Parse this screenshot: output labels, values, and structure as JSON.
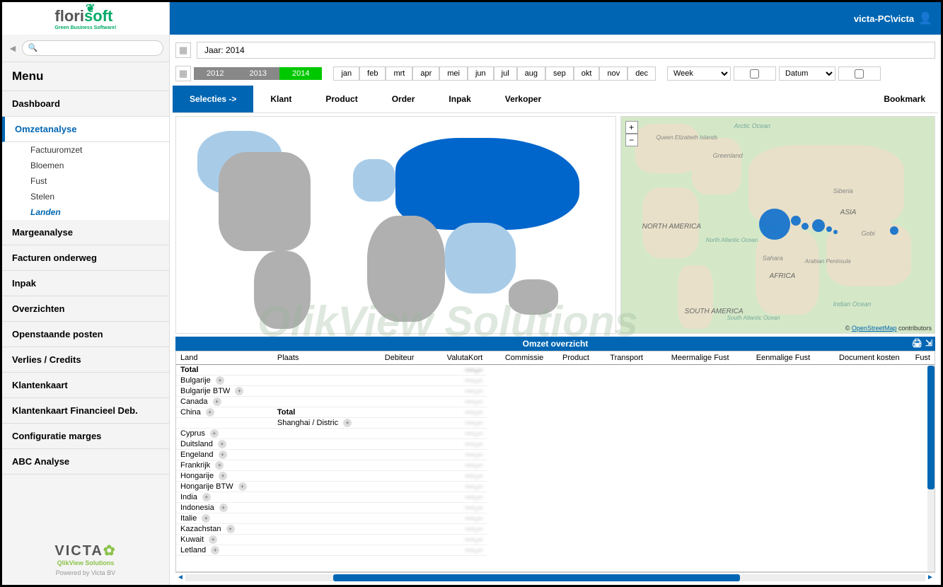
{
  "header": {
    "logo_main": "florisoft",
    "logo_sub": "Green Business Software!",
    "user": "victa-PC\\victa"
  },
  "sidebar": {
    "menu_title": "Menu",
    "items": [
      {
        "label": "Dashboard"
      },
      {
        "label": "Omzetanalyse",
        "active": true,
        "sub": [
          {
            "label": "Factuuromzet"
          },
          {
            "label": "Bloemen"
          },
          {
            "label": "Fust"
          },
          {
            "label": "Stelen"
          },
          {
            "label": "Landen",
            "active": true
          }
        ]
      },
      {
        "label": "Margeanalyse"
      },
      {
        "label": "Facturen onderweg"
      },
      {
        "label": "Inpak"
      },
      {
        "label": "Overzichten"
      },
      {
        "label": "Openstaande posten"
      },
      {
        "label": "Verlies / Credits"
      },
      {
        "label": "Klantenkaart"
      },
      {
        "label": "Klantenkaart Financieel Deb."
      },
      {
        "label": "Configuratie marges"
      },
      {
        "label": "ABC Analyse"
      }
    ],
    "footer": {
      "brand": "VICTA",
      "sub": "QlikView Solutions",
      "powered": "Powered by Victa BV"
    }
  },
  "filters": {
    "jaar_label": "Jaar: 2014",
    "years": [
      "2012",
      "2013",
      "2014"
    ],
    "year_active": "2014",
    "months": [
      "jan",
      "feb",
      "mrt",
      "apr",
      "mei",
      "jun",
      "jul",
      "aug",
      "sep",
      "okt",
      "nov",
      "dec"
    ],
    "week_label": "Week",
    "datum_label": "Datum"
  },
  "tabs": {
    "items": [
      "Selecties ->",
      "Klant",
      "Product",
      "Order",
      "Inpak",
      "Verkoper"
    ],
    "active": "Selecties ->",
    "bookmark": "Bookmark"
  },
  "map2": {
    "credit_prefix": "© ",
    "credit_link": "OpenStreetMap",
    "credit_suffix": " contributors",
    "labels": {
      "arctic": "Arctic Ocean",
      "greenland": "Greenland",
      "na": "NORTH AMERICA",
      "sa": "SOUTH AMERICA",
      "africa": "AFRICA",
      "asia": "ASIA",
      "siberia": "Siberia",
      "sahara": "Sahara",
      "gobi": "Gobi",
      "indian": "Indian Ocean",
      "natl": "North Atlantic Ocean",
      "satl": "South Atlantic Ocean",
      "arabian": "Arabian Peninsula",
      "qeliz": "Queen Elizabeth Islands"
    }
  },
  "watermark1": "VICTA",
  "watermark2": "QlikView Solutions",
  "table": {
    "title": "Omzet overzicht",
    "columns": [
      "Land",
      "Plaats",
      "Debiteur",
      "ValutaKort",
      "Commissie",
      "Product",
      "Transport",
      "Meermalige Fust",
      "Eenmalige Fust",
      "Document kosten",
      "Fust"
    ],
    "rows": [
      {
        "land": "Total",
        "total": true
      },
      {
        "land": "Bulgarije",
        "expand": true
      },
      {
        "land": "Bulgarije BTW",
        "expand": true
      },
      {
        "land": "Canada",
        "expand": true
      },
      {
        "land": "China",
        "expand": true,
        "plaats_total": "Total",
        "sub": {
          "plaats": "Shanghai / Distric",
          "expand": true
        }
      },
      {
        "land": "Cyprus",
        "expand": true
      },
      {
        "land": "Duitsland",
        "expand": true
      },
      {
        "land": "Engeland",
        "expand": true
      },
      {
        "land": "Frankrijk",
        "expand": true
      },
      {
        "land": "Hongarije",
        "expand": true
      },
      {
        "land": "Hongarije BTW",
        "expand": true
      },
      {
        "land": "India",
        "expand": true
      },
      {
        "land": "Indonesia",
        "expand": true
      },
      {
        "land": "Italie",
        "expand": true
      },
      {
        "land": "Kazachstan",
        "expand": true
      },
      {
        "land": "Kuwait",
        "expand": true
      },
      {
        "land": "Letland",
        "expand": true
      }
    ]
  }
}
